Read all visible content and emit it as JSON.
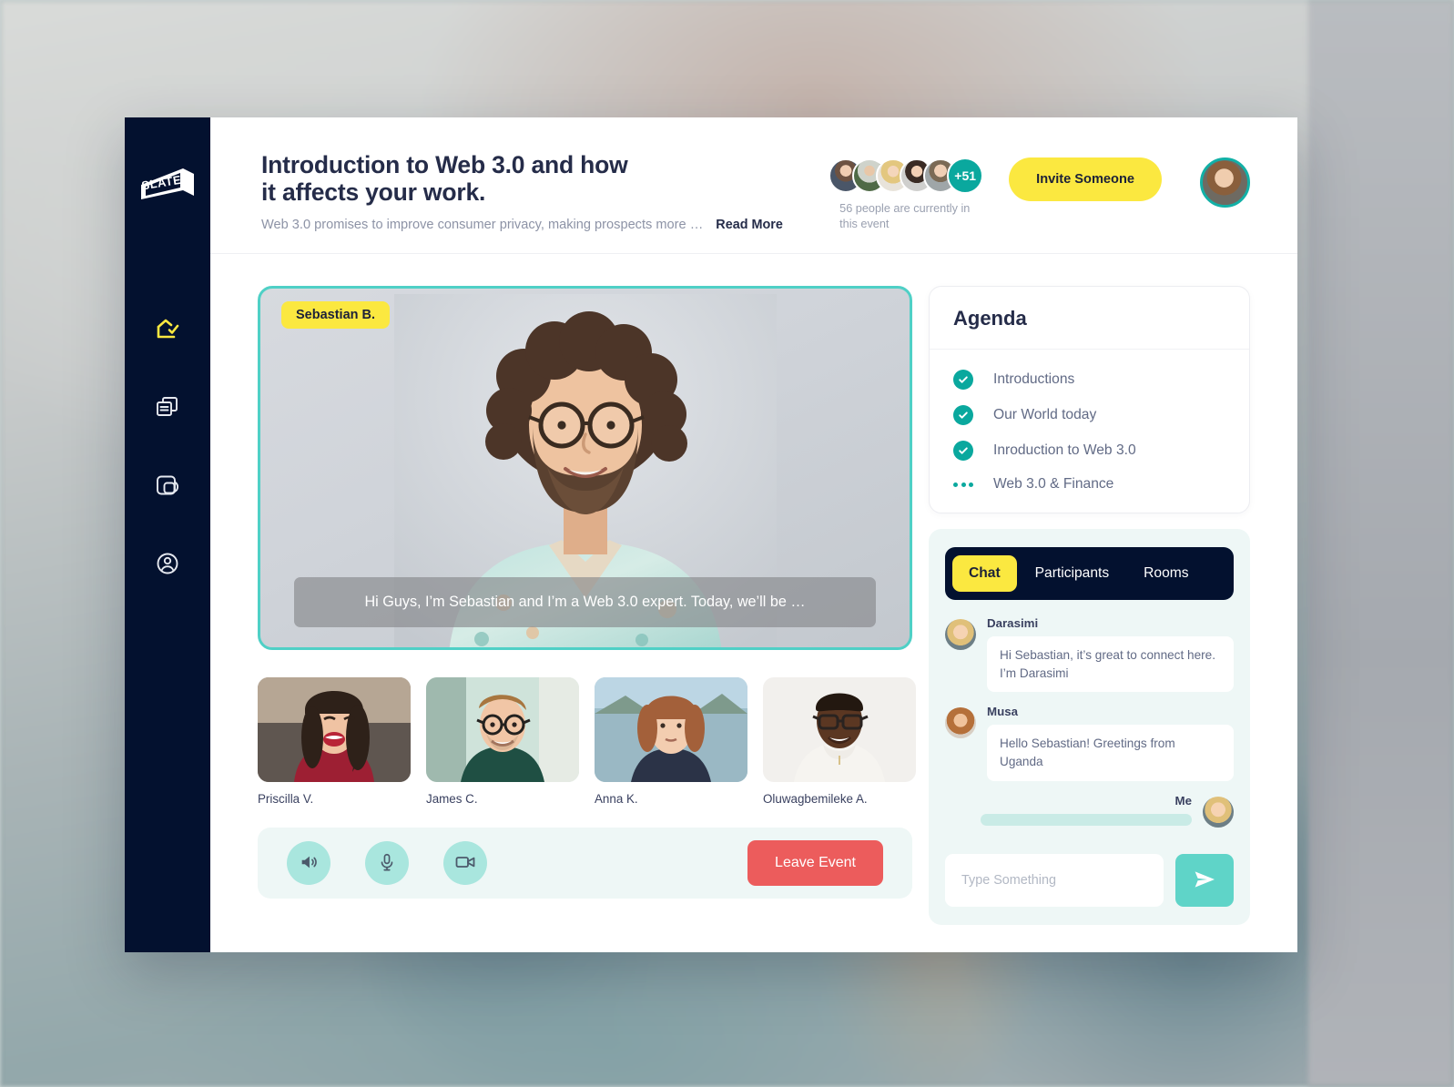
{
  "brand": {
    "logo_text": "SLATE"
  },
  "colors": {
    "navy": "#03112f",
    "yellow": "#fbe840",
    "teal": "#0aa89e",
    "teal_light": "#a9e6de",
    "teal_accent": "#5fd4c8",
    "red": "#ec5c5c",
    "text_dark": "#252c49",
    "text_muted": "#8d93a6",
    "panel_bg": "#eef7f6"
  },
  "sidebar": {
    "items": [
      {
        "icon": "home-check-icon",
        "label": "Home",
        "active": true
      },
      {
        "icon": "windows-cards-icon",
        "label": "Feed",
        "active": false
      },
      {
        "icon": "rooms-icon",
        "label": "Rooms",
        "active": false
      },
      {
        "icon": "account-circle-icon",
        "label": "Account",
        "active": false
      }
    ]
  },
  "header": {
    "title": "Introduction to Web 3.0 and how it affects your work.",
    "description": "Web 3.0 promises to improve consumer privacy, making prospects more …",
    "read_more_label": "Read More",
    "attendees": {
      "overflow_label": "+51",
      "count_text": "56 people are currently in this event",
      "avatars": [
        "attendee-1",
        "attendee-2",
        "attendee-3",
        "attendee-4",
        "attendee-5"
      ]
    },
    "invite_label": "Invite Someone",
    "profile_avatar": "current-user-avatar"
  },
  "stage": {
    "speaker_name": "Sebastian B.",
    "caption": "Hi Guys, I’m Sebastian and I’m a Web 3.0 expert. Today, we’ll be …"
  },
  "participants": [
    {
      "name": "Priscilla V."
    },
    {
      "name": "James C."
    },
    {
      "name": "Anna K."
    },
    {
      "name": "Oluwagbemileke A."
    }
  ],
  "controls": {
    "buttons": [
      {
        "icon": "speaker-icon",
        "label": "Speaker"
      },
      {
        "icon": "microphone-icon",
        "label": "Microphone"
      },
      {
        "icon": "video-camera-icon",
        "label": "Camera"
      }
    ],
    "leave_label": "Leave Event"
  },
  "agenda": {
    "title": "Agenda",
    "items": [
      {
        "label": "Introductions",
        "state": "done"
      },
      {
        "label": "Our World today",
        "state": "done"
      },
      {
        "label": "Inroduction to Web 3.0",
        "state": "done"
      },
      {
        "label": "Web 3.0 & Finance",
        "state": "pending"
      }
    ]
  },
  "chat": {
    "tabs": [
      {
        "label": "Chat",
        "active": true
      },
      {
        "label": "Participants",
        "active": false
      },
      {
        "label": "Rooms",
        "active": false
      }
    ],
    "messages": [
      {
        "author": "Darasimi",
        "text": "Hi Sebastian, it’s great to connect here. I’m Darasimi",
        "self": false
      },
      {
        "author": "Musa",
        "text": "Hello Sebastian! Greetings from Uganda",
        "self": false
      },
      {
        "author": "Me",
        "text": "",
        "self": true
      }
    ],
    "input_placeholder": "Type Something",
    "input_value": "",
    "send_icon": "send-paper-plane-icon"
  }
}
